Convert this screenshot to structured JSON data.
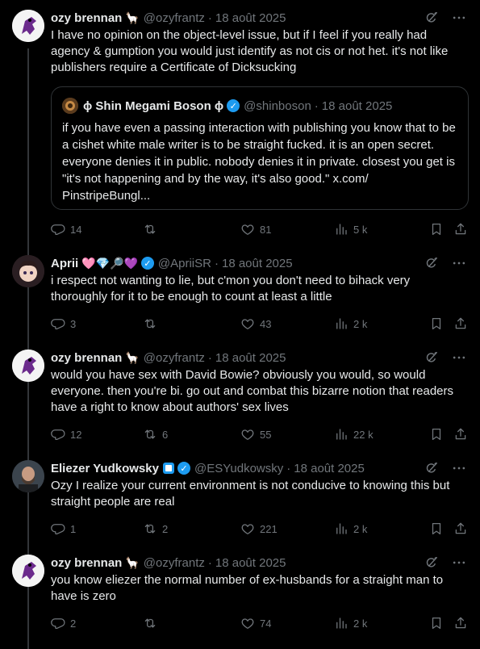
{
  "tweets": [
    {
      "name": "ozy brennan",
      "emoji": "🦙",
      "handle": "@ozyfrantz",
      "date": "18 août 2025",
      "text": "I have no opinion on the object-level issue, but if I feel if you really had agency & gumption you would just identify as not cis or not het. it's not like publishers require a Certificate of Dicksucking",
      "quote": {
        "name": "ɸ Shin Megami Boson ɸ",
        "handle": "@shinboson",
        "date": "18 août 2025",
        "text": "if you have even a passing interaction with publishing you know that to be a cishet white male writer is to be straight fucked. it is an open secret. everyone denies it in public. nobody denies it in private. closest you get is \"it's not happening and by the way, it's also good.\" x.com/ PinstripeBungl..."
      },
      "replies": "14",
      "reposts": "",
      "likes": "81",
      "views": "5 k"
    },
    {
      "name": "Aprii",
      "emoji": "🩷💎🔎💜",
      "handle": "@ApriiSR",
      "date": "18 août 2025",
      "text": "i respect not wanting to lie, but c'mon you don't need to bihack very thoroughly for it to be enough to count at least a little",
      "replies": "3",
      "reposts": "",
      "likes": "43",
      "views": "2 k"
    },
    {
      "name": "ozy brennan",
      "emoji": "🦙",
      "handle": "@ozyfrantz",
      "date": "18 août 2025",
      "text": "would you have sex with David Bowie? obviously you would, so would everyone. then you're bi. go out and combat this bizarre notion that readers have a right to know about authors' sex lives",
      "replies": "12",
      "reposts": "6",
      "likes": "55",
      "views": "22 k"
    },
    {
      "name": "Eliezer Yudkowsky",
      "handle": "@ESYudkowsky",
      "date": "18 août 2025",
      "text": "Ozy I realize your current environment is not conducive to knowing this but straight people are real",
      "replies": "1",
      "reposts": "2",
      "likes": "221",
      "views": "2 k"
    },
    {
      "name": "ozy brennan",
      "emoji": "🦙",
      "handle": "@ozyfrantz",
      "date": "18 août 2025",
      "text": "you know eliezer the normal number of ex-husbands for a straight man to have is zero",
      "replies": "2",
      "reposts": "",
      "likes": "74",
      "views": "2 k"
    }
  ],
  "separator": "·",
  "icons": {
    "more": "more-icon",
    "grok": "grok-icon",
    "reply": "reply-icon",
    "repost": "repost-icon",
    "like": "like-icon",
    "views": "views-icon",
    "bookmark": "bookmark-icon",
    "share": "share-icon"
  },
  "colors": {
    "background": "#000000",
    "text": "#e7e9ea",
    "muted": "#71767b",
    "verified": "#1d9bf0",
    "border": "#2f3336"
  }
}
